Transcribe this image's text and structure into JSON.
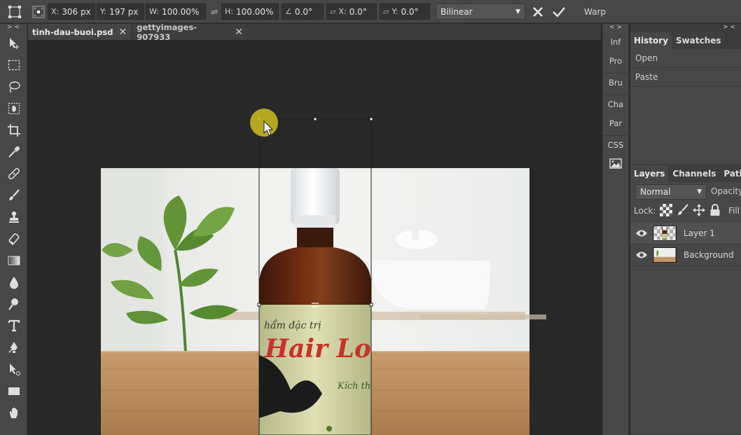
{
  "options_bar": {
    "x_label": "X:",
    "x_value": "306 px",
    "y_label": "Y:",
    "y_value": "197 px",
    "w_label": "W:",
    "w_value": "100.00%",
    "h_label": "H:",
    "h_value": "100.00%",
    "angle_value": "0.0°",
    "skew_x_label": "X:",
    "skew_x_value": "0.0°",
    "skew_y_label": "Y:",
    "skew_y_value": "0.0°",
    "interpolation": "Bilinear",
    "warp_label": "Warp"
  },
  "tabs": [
    {
      "label": "tinh-dau-buoi.psd"
    },
    {
      "label": "gettyimages-907933"
    }
  ],
  "mini_panels": [
    "Inf",
    "Pro",
    "Bru",
    "Cha",
    "Par",
    "CSS"
  ],
  "history_panel": {
    "tabs": [
      "History",
      "Swatches"
    ],
    "items": [
      "Open",
      "Paste"
    ]
  },
  "layers_panel": {
    "tabs": [
      "Layers",
      "Channels",
      "Path"
    ],
    "blend_mode": "Normal",
    "opacity_label": "Opacity",
    "lock_label": "Lock:",
    "fill_label": "Fill",
    "layers": [
      {
        "name": "Layer 1",
        "active": true
      },
      {
        "name": "Background",
        "active": false
      }
    ]
  },
  "canvas": {
    "label_line1": "hẩm đặc trị",
    "label_brand": "Hair Lo",
    "label_line3": "Kích th"
  },
  "colors": {
    "ui_panel": "#474747",
    "canvas_bg": "#282828",
    "cursor_highlight": "#c5b51f",
    "label_red": "#c8322a"
  }
}
